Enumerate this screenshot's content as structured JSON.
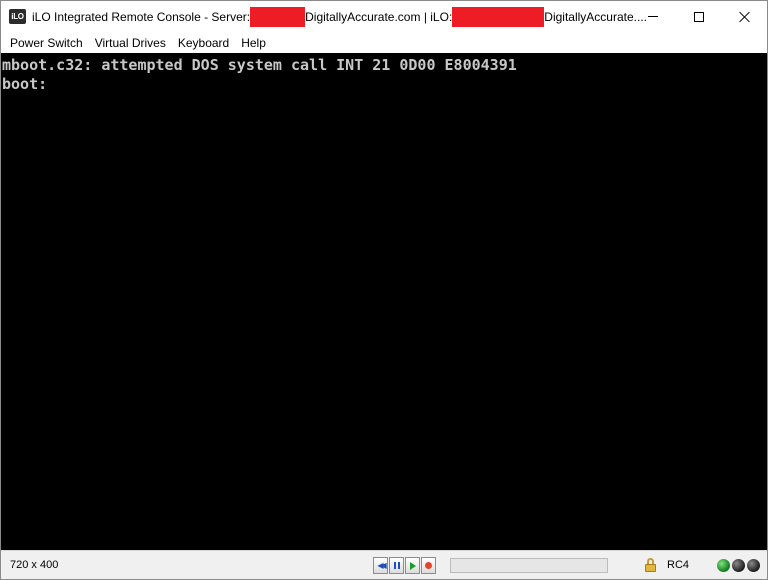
{
  "window": {
    "title_prefix": "iLO Integrated Remote Console - Server:",
    "title_middle": "DigitallyAccurate.com | iLO:",
    "title_suffix": "DigitallyAccurate....",
    "app_icon_text": "iLO"
  },
  "menu": {
    "items": [
      {
        "label": "Power Switch"
      },
      {
        "label": "Virtual Drives"
      },
      {
        "label": "Keyboard"
      },
      {
        "label": "Help"
      }
    ]
  },
  "console": {
    "lines": [
      "mboot.c32: attempted DOS system call INT 21 0D00 E8004391",
      "boot:"
    ]
  },
  "status": {
    "resolution": "720 x 400",
    "encryption": "RC4",
    "progress_fraction": 0,
    "leds": [
      "green",
      "dark",
      "dark"
    ]
  },
  "colors": {
    "redaction": "#ee1c25",
    "console_bg": "#000000",
    "console_fg": "#c8c8c8"
  },
  "icons": {
    "app": "ilo-icon",
    "minimize": "minimize-icon",
    "maximize": "maximize-icon",
    "close": "close-icon",
    "rewind": "rewind-icon",
    "pause": "pause-icon",
    "play": "play-icon",
    "record": "record-icon",
    "lock": "lock-icon"
  }
}
